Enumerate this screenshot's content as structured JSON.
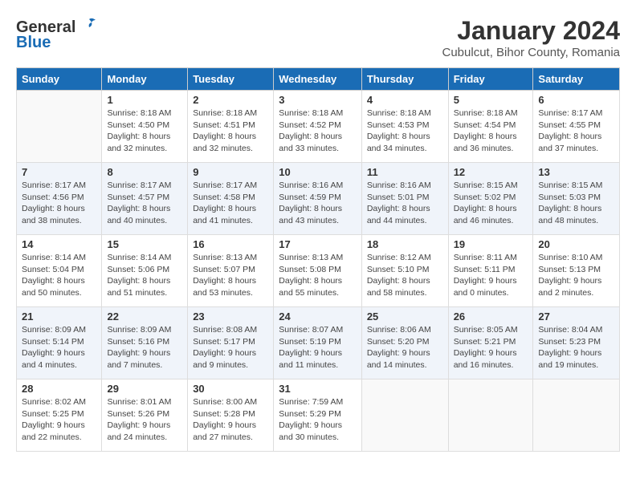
{
  "logo": {
    "general": "General",
    "blue": "Blue"
  },
  "title": "January 2024",
  "location": "Cubulcut, Bihor County, Romania",
  "days_of_week": [
    "Sunday",
    "Monday",
    "Tuesday",
    "Wednesday",
    "Thursday",
    "Friday",
    "Saturday"
  ],
  "weeks": [
    [
      {
        "day": "",
        "info": ""
      },
      {
        "day": "1",
        "info": "Sunrise: 8:18 AM\nSunset: 4:50 PM\nDaylight: 8 hours\nand 32 minutes."
      },
      {
        "day": "2",
        "info": "Sunrise: 8:18 AM\nSunset: 4:51 PM\nDaylight: 8 hours\nand 32 minutes."
      },
      {
        "day": "3",
        "info": "Sunrise: 8:18 AM\nSunset: 4:52 PM\nDaylight: 8 hours\nand 33 minutes."
      },
      {
        "day": "4",
        "info": "Sunrise: 8:18 AM\nSunset: 4:53 PM\nDaylight: 8 hours\nand 34 minutes."
      },
      {
        "day": "5",
        "info": "Sunrise: 8:18 AM\nSunset: 4:54 PM\nDaylight: 8 hours\nand 36 minutes."
      },
      {
        "day": "6",
        "info": "Sunrise: 8:17 AM\nSunset: 4:55 PM\nDaylight: 8 hours\nand 37 minutes."
      }
    ],
    [
      {
        "day": "7",
        "info": "Sunrise: 8:17 AM\nSunset: 4:56 PM\nDaylight: 8 hours\nand 38 minutes."
      },
      {
        "day": "8",
        "info": "Sunrise: 8:17 AM\nSunset: 4:57 PM\nDaylight: 8 hours\nand 40 minutes."
      },
      {
        "day": "9",
        "info": "Sunrise: 8:17 AM\nSunset: 4:58 PM\nDaylight: 8 hours\nand 41 minutes."
      },
      {
        "day": "10",
        "info": "Sunrise: 8:16 AM\nSunset: 4:59 PM\nDaylight: 8 hours\nand 43 minutes."
      },
      {
        "day": "11",
        "info": "Sunrise: 8:16 AM\nSunset: 5:01 PM\nDaylight: 8 hours\nand 44 minutes."
      },
      {
        "day": "12",
        "info": "Sunrise: 8:15 AM\nSunset: 5:02 PM\nDaylight: 8 hours\nand 46 minutes."
      },
      {
        "day": "13",
        "info": "Sunrise: 8:15 AM\nSunset: 5:03 PM\nDaylight: 8 hours\nand 48 minutes."
      }
    ],
    [
      {
        "day": "14",
        "info": "Sunrise: 8:14 AM\nSunset: 5:04 PM\nDaylight: 8 hours\nand 50 minutes."
      },
      {
        "day": "15",
        "info": "Sunrise: 8:14 AM\nSunset: 5:06 PM\nDaylight: 8 hours\nand 51 minutes."
      },
      {
        "day": "16",
        "info": "Sunrise: 8:13 AM\nSunset: 5:07 PM\nDaylight: 8 hours\nand 53 minutes."
      },
      {
        "day": "17",
        "info": "Sunrise: 8:13 AM\nSunset: 5:08 PM\nDaylight: 8 hours\nand 55 minutes."
      },
      {
        "day": "18",
        "info": "Sunrise: 8:12 AM\nSunset: 5:10 PM\nDaylight: 8 hours\nand 58 minutes."
      },
      {
        "day": "19",
        "info": "Sunrise: 8:11 AM\nSunset: 5:11 PM\nDaylight: 9 hours\nand 0 minutes."
      },
      {
        "day": "20",
        "info": "Sunrise: 8:10 AM\nSunset: 5:13 PM\nDaylight: 9 hours\nand 2 minutes."
      }
    ],
    [
      {
        "day": "21",
        "info": "Sunrise: 8:09 AM\nSunset: 5:14 PM\nDaylight: 9 hours\nand 4 minutes."
      },
      {
        "day": "22",
        "info": "Sunrise: 8:09 AM\nSunset: 5:16 PM\nDaylight: 9 hours\nand 7 minutes."
      },
      {
        "day": "23",
        "info": "Sunrise: 8:08 AM\nSunset: 5:17 PM\nDaylight: 9 hours\nand 9 minutes."
      },
      {
        "day": "24",
        "info": "Sunrise: 8:07 AM\nSunset: 5:19 PM\nDaylight: 9 hours\nand 11 minutes."
      },
      {
        "day": "25",
        "info": "Sunrise: 8:06 AM\nSunset: 5:20 PM\nDaylight: 9 hours\nand 14 minutes."
      },
      {
        "day": "26",
        "info": "Sunrise: 8:05 AM\nSunset: 5:21 PM\nDaylight: 9 hours\nand 16 minutes."
      },
      {
        "day": "27",
        "info": "Sunrise: 8:04 AM\nSunset: 5:23 PM\nDaylight: 9 hours\nand 19 minutes."
      }
    ],
    [
      {
        "day": "28",
        "info": "Sunrise: 8:02 AM\nSunset: 5:25 PM\nDaylight: 9 hours\nand 22 minutes."
      },
      {
        "day": "29",
        "info": "Sunrise: 8:01 AM\nSunset: 5:26 PM\nDaylight: 9 hours\nand 24 minutes."
      },
      {
        "day": "30",
        "info": "Sunrise: 8:00 AM\nSunset: 5:28 PM\nDaylight: 9 hours\nand 27 minutes."
      },
      {
        "day": "31",
        "info": "Sunrise: 7:59 AM\nSunset: 5:29 PM\nDaylight: 9 hours\nand 30 minutes."
      },
      {
        "day": "",
        "info": ""
      },
      {
        "day": "",
        "info": ""
      },
      {
        "day": "",
        "info": ""
      }
    ]
  ]
}
